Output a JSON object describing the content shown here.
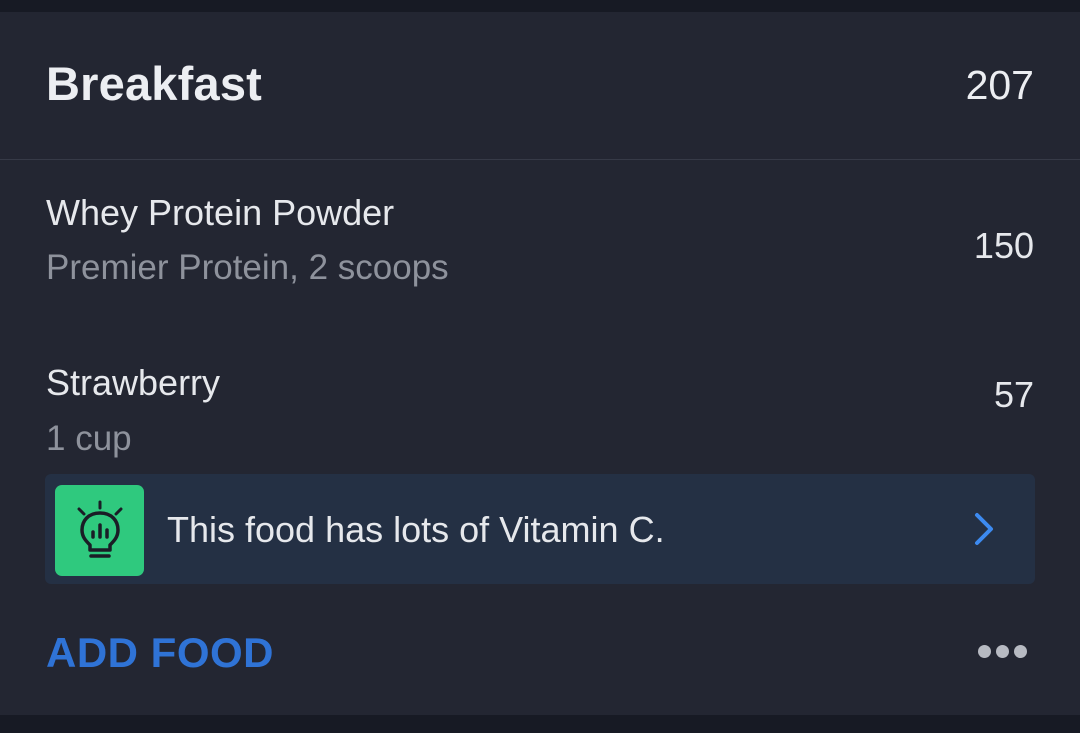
{
  "meal": {
    "title": "Breakfast",
    "total_calories": "207"
  },
  "foods": [
    {
      "name": "Whey Protein Powder",
      "detail": "Premier Protein, 2 scoops",
      "calories": "150"
    },
    {
      "name": "Strawberry",
      "detail": "1 cup",
      "calories": "57"
    }
  ],
  "tip": {
    "icon": "lightbulb-icon",
    "text": "This food has lots of Vitamin C.",
    "chevron": "chevron-right-icon"
  },
  "actions": {
    "add_food_label": "ADD FOOD",
    "more_icon": "more-horizontal-icon"
  },
  "colors": {
    "background": "#232632",
    "accent_blue": "#2f73d6",
    "tip_green": "#2fc97e",
    "tip_banner": "#243044"
  }
}
